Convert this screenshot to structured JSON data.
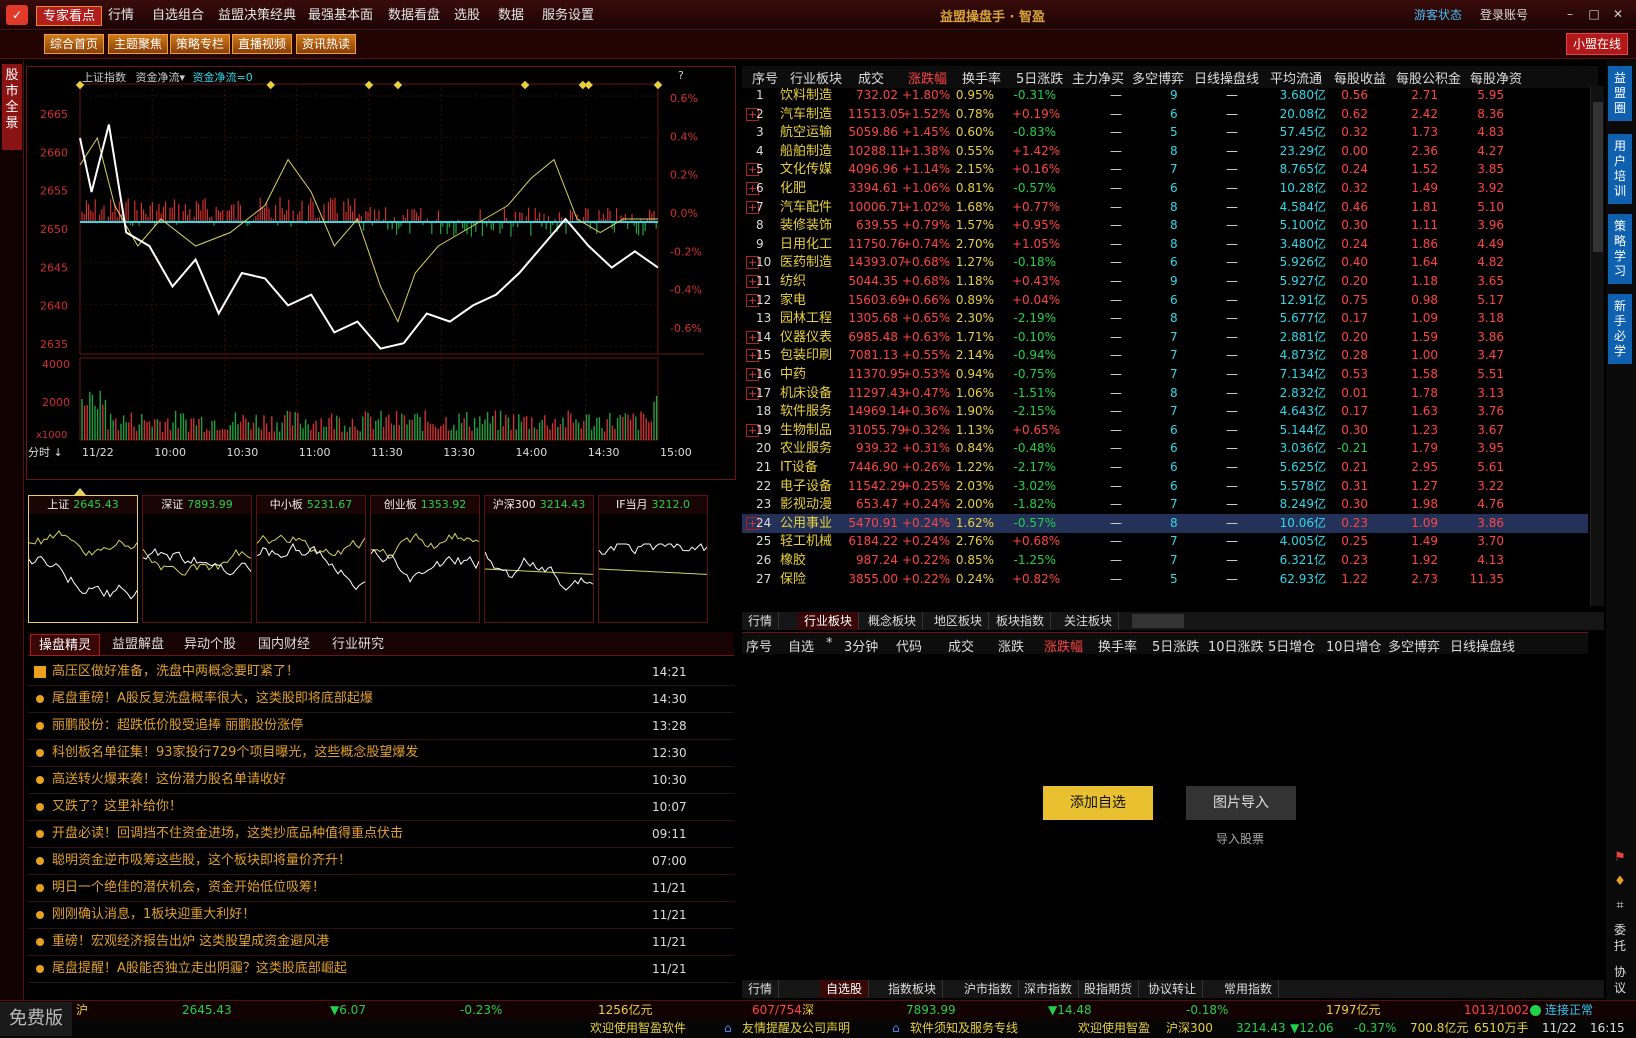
{
  "title_menu": [
    "专家看点",
    "行情",
    "自选组合",
    "益盟决策经典",
    "最强基本面",
    "数据看盘",
    "选股",
    "数据",
    "服务设置"
  ],
  "app_title": "益盟操盘手 · 智盈",
  "window": {
    "status": "游客状态",
    "login": "登录账号"
  },
  "toolbar": [
    "综合首页",
    "主题聚焦",
    "策略专栏",
    "直播视频",
    "资讯热读"
  ],
  "xiaomeng": "小盟在线",
  "left_tab": "股市全景",
  "chart": {
    "index_name": "上证指数",
    "flow_menu": "资金净流",
    "flow_value": "资金净流=0",
    "help": "?",
    "y_ticks": [
      "2665",
      "2660",
      "2655",
      "2650",
      "2645",
      "2640",
      "2635"
    ],
    "r_ticks": [
      "0.6%",
      "0.4%",
      "0.2%",
      "0.0%",
      "-0.2%",
      "-0.4%",
      "-0.6%"
    ],
    "vol_ticks": [
      "4000",
      "2000"
    ],
    "vol_unit": "x1000",
    "x_ticks": [
      "11/22",
      "10:00",
      "10:30",
      "11:00",
      "11:30",
      "13:30",
      "14:00",
      "14:30",
      "15:00"
    ],
    "period": "分时"
  },
  "cards": [
    {
      "name": "上证",
      "value": "2645.43"
    },
    {
      "name": "深证",
      "value": "7893.99"
    },
    {
      "name": "中小板",
      "value": "5231.67"
    },
    {
      "name": "创业板",
      "value": "1353.92"
    },
    {
      "name": "沪深300",
      "value": "3214.43"
    },
    {
      "name": "IF当月",
      "value": "3212.0"
    }
  ],
  "news_tabs": [
    "操盘精灵",
    "益盟解盘",
    "异动个股",
    "国内财经",
    "行业研究"
  ],
  "news": [
    {
      "text": "高压区做好准备，洗盘中两概念要盯紧了！",
      "time": "14:21"
    },
    {
      "text": "尾盘重磅！A股反复洗盘概率很大，这类股即将底部起爆",
      "time": "14:30"
    },
    {
      "text": "丽鹏股份：超跌低价股受追捧 丽鹏股份涨停",
      "time": "13:28"
    },
    {
      "text": "科创板名单征集！93家投行729个项目曝光，这些概念股望爆发",
      "time": "12:30"
    },
    {
      "text": "高送转火爆来袭！这份潜力股名单请收好",
      "time": "10:30"
    },
    {
      "text": "又跌了？这里补给你！",
      "time": "10:07"
    },
    {
      "text": "开盘必读！回调挡不住资金进场，这类抄底品种值得重点伏击",
      "time": "09:11"
    },
    {
      "text": "聪明资金逆市吸筹这些股，这个板块即将量价齐升！",
      "time": "07:00"
    },
    {
      "text": "明日一个绝佳的潜伏机会，资金开始低位吸筹！",
      "time": "11/21"
    },
    {
      "text": "刚刚确认消息，1板块迎重大利好！",
      "time": "11/21"
    },
    {
      "text": "重磅！宏观经济报告出炉 这类股望成资金避风港",
      "time": "11/21"
    },
    {
      "text": "尾盘提醒！A股能否独立走出阴霾？这类股底部崛起",
      "time": "11/21"
    }
  ],
  "table_headers": [
    "序号",
    "行业板块",
    "成交",
    "涨跌幅",
    "换手率",
    "5日涨跌",
    "主力净买",
    "多空博弈",
    "日线操盘线",
    "平均流通",
    "每股收益",
    "每股公积金",
    "每股净资"
  ],
  "rows": [
    [
      "1",
      "饮料制造",
      "732.02",
      "+1.80%",
      "0.95%",
      "-0.31%",
      "—",
      "9",
      "—",
      "3.680亿",
      "0.56",
      "2.71",
      "5.95"
    ],
    [
      "2",
      "汽车制造",
      "11513.05",
      "+1.52%",
      "0.78%",
      "+0.19%",
      "—",
      "6",
      "—",
      "20.08亿",
      "0.62",
      "2.42",
      "8.36"
    ],
    [
      "3",
      "航空运输",
      "5059.86",
      "+1.45%",
      "0.60%",
      "-0.83%",
      "—",
      "5",
      "—",
      "57.45亿",
      "0.32",
      "1.73",
      "4.83"
    ],
    [
      "4",
      "船舶制造",
      "10288.11",
      "+1.38%",
      "0.55%",
      "+1.42%",
      "—",
      "8",
      "—",
      "23.29亿",
      "0.00",
      "2.36",
      "4.27"
    ],
    [
      "5",
      "文化传媒",
      "4096.96",
      "+1.14%",
      "2.15%",
      "+0.16%",
      "—",
      "7",
      "—",
      "8.765亿",
      "0.24",
      "1.52",
      "3.85"
    ],
    [
      "6",
      "化肥",
      "3394.61",
      "+1.06%",
      "0.81%",
      "-0.57%",
      "—",
      "6",
      "—",
      "10.28亿",
      "0.32",
      "1.49",
      "3.92"
    ],
    [
      "7",
      "汽车配件",
      "10006.71",
      "+1.02%",
      "1.68%",
      "+0.77%",
      "—",
      "8",
      "—",
      "4.584亿",
      "0.46",
      "1.81",
      "5.10"
    ],
    [
      "8",
      "装修装饰",
      "639.55",
      "+0.79%",
      "1.57%",
      "+0.95%",
      "—",
      "8",
      "—",
      "5.100亿",
      "0.30",
      "1.11",
      "3.96"
    ],
    [
      "9",
      "日用化工",
      "11750.76",
      "+0.74%",
      "2.70%",
      "+1.05%",
      "—",
      "8",
      "—",
      "3.480亿",
      "0.24",
      "1.86",
      "4.49"
    ],
    [
      "10",
      "医药制造",
      "14393.07",
      "+0.68%",
      "1.27%",
      "-0.18%",
      "—",
      "6",
      "—",
      "5.926亿",
      "0.40",
      "1.64",
      "4.82"
    ],
    [
      "11",
      "纺织",
      "5044.35",
      "+0.68%",
      "1.18%",
      "+0.43%",
      "—",
      "9",
      "—",
      "5.927亿",
      "0.20",
      "1.18",
      "3.65"
    ],
    [
      "12",
      "家电",
      "15603.69",
      "+0.66%",
      "0.89%",
      "+0.04%",
      "—",
      "6",
      "—",
      "12.91亿",
      "0.75",
      "0.98",
      "5.17"
    ],
    [
      "13",
      "园林工程",
      "1305.68",
      "+0.65%",
      "2.30%",
      "-2.19%",
      "—",
      "8",
      "—",
      "5.677亿",
      "0.17",
      "1.09",
      "3.18"
    ],
    [
      "14",
      "仪器仪表",
      "6985.48",
      "+0.63%",
      "1.71%",
      "-0.10%",
      "—",
      "7",
      "—",
      "2.881亿",
      "0.20",
      "1.59",
      "3.86"
    ],
    [
      "15",
      "包装印刷",
      "7081.13",
      "+0.55%",
      "2.14%",
      "-0.94%",
      "—",
      "7",
      "—",
      "4.873亿",
      "0.28",
      "1.00",
      "3.47"
    ],
    [
      "16",
      "中药",
      "11370.95",
      "+0.53%",
      "0.94%",
      "-0.75%",
      "—",
      "7",
      "—",
      "7.134亿",
      "0.53",
      "1.58",
      "5.51"
    ],
    [
      "17",
      "机床设备",
      "11297.43",
      "+0.47%",
      "1.06%",
      "-1.51%",
      "—",
      "8",
      "—",
      "2.832亿",
      "0.01",
      "1.78",
      "3.13"
    ],
    [
      "18",
      "软件服务",
      "14969.14",
      "+0.36%",
      "1.90%",
      "-2.15%",
      "—",
      "7",
      "—",
      "4.643亿",
      "0.17",
      "1.63",
      "3.76"
    ],
    [
      "19",
      "生物制品",
      "31055.79",
      "+0.32%",
      "1.13%",
      "+0.65%",
      "—",
      "6",
      "—",
      "5.144亿",
      "0.30",
      "1.23",
      "3.67"
    ],
    [
      "20",
      "农业服务",
      "939.32",
      "+0.31%",
      "0.84%",
      "-0.48%",
      "—",
      "6",
      "—",
      "3.036亿",
      "-0.21",
      "1.79",
      "3.95"
    ],
    [
      "21",
      "IT设备",
      "7446.90",
      "+0.26%",
      "1.22%",
      "-2.17%",
      "—",
      "6",
      "—",
      "5.625亿",
      "0.21",
      "2.95",
      "5.61"
    ],
    [
      "22",
      "电子设备",
      "11542.29",
      "+0.25%",
      "2.03%",
      "-3.02%",
      "—",
      "6",
      "—",
      "5.578亿",
      "0.31",
      "1.27",
      "3.22"
    ],
    [
      "23",
      "影视动漫",
      "653.47",
      "+0.24%",
      "2.00%",
      "-1.82%",
      "—",
      "7",
      "—",
      "8.249亿",
      "0.30",
      "1.98",
      "4.76"
    ],
    [
      "24",
      "公用事业",
      "5470.91",
      "+0.24%",
      "1.62%",
      "-0.57%",
      "—",
      "8",
      "—",
      "10.06亿",
      "0.23",
      "1.09",
      "3.86"
    ],
    [
      "25",
      "轻工机械",
      "6184.22",
      "+0.24%",
      "2.76%",
      "+0.68%",
      "—",
      "7",
      "—",
      "4.005亿",
      "0.25",
      "1.49",
      "3.70"
    ],
    [
      "26",
      "橡胶",
      "987.24",
      "+0.22%",
      "0.85%",
      "-1.25%",
      "—",
      "7",
      "—",
      "6.321亿",
      "0.23",
      "1.92",
      "4.13"
    ],
    [
      "27",
      "保险",
      "3855.00",
      "+0.22%",
      "0.24%",
      "+0.82%",
      "—",
      "5",
      "—",
      "62.93亿",
      "1.22",
      "2.73",
      "11.35"
    ]
  ],
  "plus_rows": [
    1,
    4,
    5,
    6,
    9,
    10,
    11,
    13,
    14,
    15,
    16,
    18,
    23
  ],
  "highlight_row": 23,
  "sector_tabs": [
    "行情",
    "行业板块",
    "概念板块",
    "地区板块",
    "板块指数",
    "关注板块"
  ],
  "watch_headers": [
    "序号",
    "自选",
    "*",
    "3分钟",
    "代码",
    "成交",
    "涨跌",
    "涨跌幅",
    "换手率",
    "5日涨跌",
    "10日涨跌",
    "5日增仓",
    "10日增仓",
    "多空博弈",
    "日线操盘线"
  ],
  "add_watch": "添加自选",
  "image_import": "图片导入",
  "import_label": "导入股票",
  "watch_tabs": [
    "行情",
    "自选股",
    "指数板块",
    "沪市指数",
    "深市指数",
    "股指期货",
    "协议转让",
    "常用指数"
  ],
  "right_tabs": [
    "益盟圈",
    "用户培训",
    "策略学习",
    "新手必学"
  ],
  "right_bottom": [
    "委托",
    "协议"
  ],
  "status_top": {
    "sh_label": "沪",
    "sh_val": "2645.43",
    "sh_chg": "▼6.07",
    "sh_pct": "-0.23%",
    "sh_amt": "1256亿元",
    "sh_ud": "607/754",
    "sz_label": "深",
    "sz_val": "7893.99",
    "sz_chg": "▼14.48",
    "sz_pct": "-0.18%",
    "sz_amt": "1797亿元",
    "sz_ud": "1013/1002",
    "conn": "连接正常"
  },
  "status_bottom": {
    "free": "免费版",
    "msg1": "欢迎使用智盈软件",
    "msg2": "友情提醒及公司声明",
    "msg3": "软件须知及服务专线",
    "msg4": "欢迎使用智盈",
    "hs_label": "沪深300",
    "hs_val": "3214.43",
    "hs_chg": "▼12.06",
    "hs_pct": "-0.37%",
    "hs_amt": "700.8亿元",
    "hs_vol": "6510万手",
    "date": "11/22",
    "time": "16:15"
  },
  "colors": {
    "up": "#ff4444",
    "down": "#22d04a",
    "accent": "#e8a020",
    "bg": "#000000",
    "frame": "#6a1515"
  }
}
